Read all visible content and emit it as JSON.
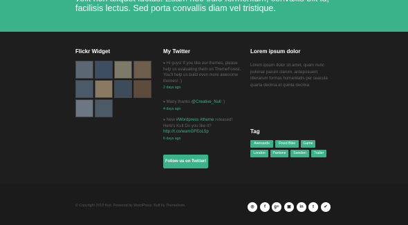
{
  "hero": {
    "text": "velit non aliquet luctus. Etiam nec odio fermentum, convallis elit id, facilisis lectus. Sed porta convallis diam vel tristique."
  },
  "flickr": {
    "title": "Flickr Widget",
    "thumbnails": [
      {
        "color": "#5b6773"
      },
      {
        "color": "#3e4e61"
      },
      {
        "color": "#7d7a6a"
      },
      {
        "color": "#6e5d4a"
      },
      {
        "color": "#4b5a68"
      },
      {
        "color": "#8a7a62"
      },
      {
        "color": "#3d4c5a"
      },
      {
        "color": "#5f4b3c"
      },
      {
        "color": "#6d7684"
      },
      {
        "color": "#4c5966"
      }
    ]
  },
  "twitter": {
    "title": "My Twitter",
    "tweets": [
      {
        "text": "Hi guys! If you like our themes, please help us evaluating them on ThemeForest. You'll help us build even more awesome themes! :)",
        "ago": "2 days ago"
      },
      {
        "text_pre": "Many thanks ",
        "mention": "@Creative_Null",
        "text_post": " :)",
        "ago": "4 days ago"
      },
      {
        "text_pre": "New ",
        "hashtag1": "#Wordpress",
        "hashtag2": "#theme",
        "text_post": " released! Here's Kult Do you like it?",
        "link": "http://t.co/wamGFEoL5p",
        "ago": "6 days ago"
      }
    ],
    "follow_label": "Follow us on Twitter!"
  },
  "lorem": {
    "title": "Lorem ipsum dolor",
    "text": "Lorem ipsum dolor sit amet, quam nunc pulvinar parum clarum, anteposuerit litterarum formas humanitatis per seacula quarta decima et quinta decima."
  },
  "tags": {
    "title": "Tag",
    "items": [
      "Awesards",
      "Fixed Bike",
      "Game",
      "London",
      "Pantone",
      "Sweden",
      "Trailer"
    ]
  },
  "footer": {
    "copyright": "© Copyright 2013 Kult. Powered by WordPress. Kult by Themelovin.",
    "social": [
      {
        "icon": "dribbble-icon",
        "glyph": "◎"
      },
      {
        "icon": "facebook-icon",
        "glyph": "f"
      },
      {
        "icon": "googleplus-icon",
        "glyph": "g+"
      },
      {
        "icon": "instagram-icon",
        "glyph": "▣"
      },
      {
        "icon": "linkedin-icon",
        "glyph": "in"
      },
      {
        "icon": "tumblr-icon",
        "glyph": "t"
      },
      {
        "icon": "twitter-icon",
        "glyph": "✔"
      }
    ]
  },
  "colors": {
    "accent": "#3bb38a",
    "background": "#1e1e1e"
  }
}
